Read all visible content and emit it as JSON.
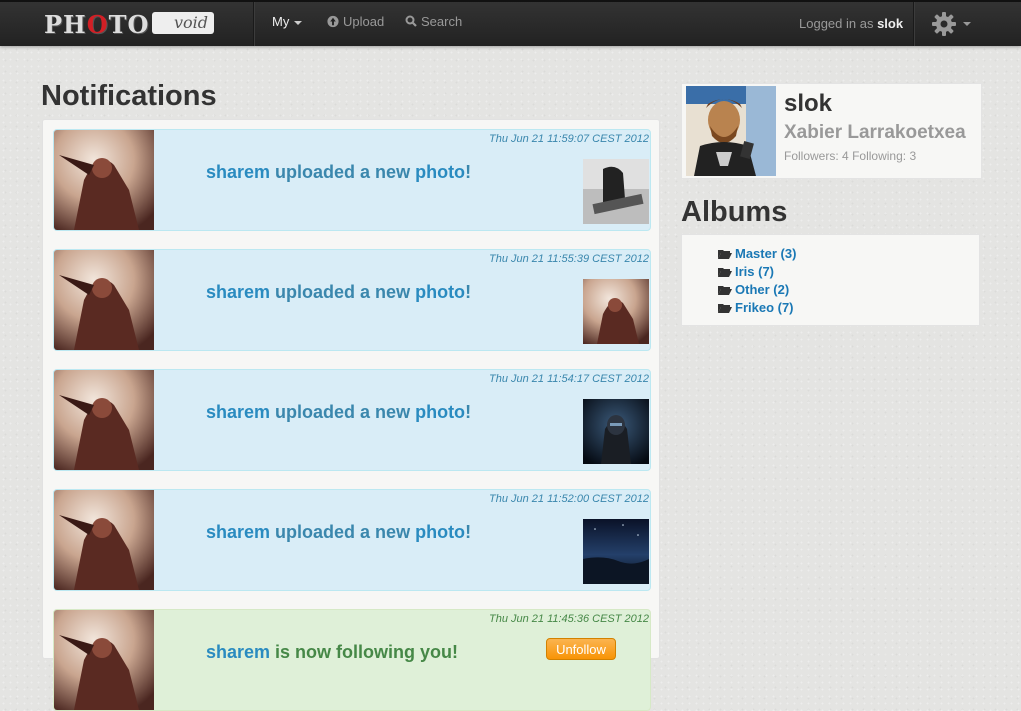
{
  "navbar": {
    "brand_text": "PHOTO",
    "brand_suffix": "void",
    "my_label": "My",
    "upload_label": "Upload",
    "search_label": "Search",
    "logged_prefix": "Logged in as",
    "logged_user": "slok"
  },
  "notifications": {
    "title": "Notifications",
    "items": [
      {
        "time": "Thu Jun 21 11:59:07 CEST 2012",
        "user": "sharem",
        "text": " uploaded a new ",
        "link": "photo",
        "suffix": "!"
      },
      {
        "time": "Thu Jun 21 11:55:39 CEST 2012",
        "user": "sharem",
        "text": " uploaded a new ",
        "link": "photo",
        "suffix": "!"
      },
      {
        "time": "Thu Jun 21 11:54:17 CEST 2012",
        "user": "sharem",
        "text": " uploaded a new ",
        "link": "photo",
        "suffix": "!"
      },
      {
        "time": "Thu Jun 21 11:52:00 CEST 2012",
        "user": "sharem",
        "text": " uploaded a new ",
        "link": "photo",
        "suffix": "!"
      },
      {
        "time": "Thu Jun 21 11:45:36 CEST 2012",
        "user": "sharem",
        "text": " is now following you!",
        "button": "Unfollow"
      }
    ]
  },
  "profile": {
    "username": "slok",
    "fullname": "Xabier Larrakoetxea",
    "followers_label": "Followers:",
    "followers": "4",
    "following_label": "Following:",
    "following": "3"
  },
  "albums": {
    "title": "Albums",
    "items": [
      {
        "label": "Master (3)"
      },
      {
        "label": "Iris (7)"
      },
      {
        "label": "Other (2)"
      },
      {
        "label": "Frikeo (7)"
      }
    ]
  },
  "colors": {
    "info_bg": "#d9edf7",
    "info_text": "#3a87ad",
    "success_bg": "#dff0d8",
    "success_text": "#468847",
    "link": "#2a8bc0",
    "warning_button": "#f89406"
  }
}
